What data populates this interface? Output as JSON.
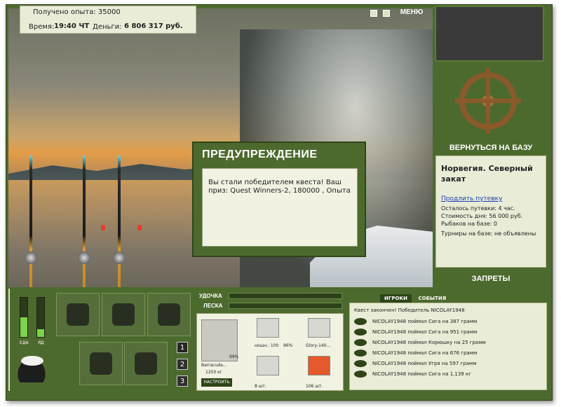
{
  "status": {
    "experience_label": "Получено опыта: 35000",
    "time_label": "Время:",
    "time_value": "19:40 ЧТ",
    "money_label": "Деньги:",
    "money_value": "6 806 317 руб."
  },
  "top": {
    "menu_label": "МЕНЮ"
  },
  "right": {
    "return_label": "ВЕРНУТЬСЯ НА БАЗУ",
    "base_title": "Норвегия. Северный закат",
    "extend_link": "Продлить путевку",
    "lines": [
      "Осталось путевки: 4 час.",
      "Стоимость дня: 56 000 руб.",
      "Рыбаков на базе: 0",
      "Турниры на базе: не объявлены"
    ],
    "bans_label": "ЗАПРЕТЫ"
  },
  "dialog": {
    "title": "ПРЕДУПРЕЖДЕНИЕ",
    "message": "Вы стали победителем квеста! Ваш приз: Quest Winners-2, 180000 , Опыта"
  },
  "left": {
    "gauge_food_label": "ЕДА",
    "gauge_poison_label": "ЯД",
    "gauge_food_value": 0.5,
    "gauge_poison_value": 0.2,
    "pages": [
      "1",
      "2",
      "3"
    ]
  },
  "tackle": {
    "rod_label": "УДОЧКА",
    "line_label": "ЛЕСКА",
    "rod_name": "Barracuda...",
    "rod_weight": "1250 кг",
    "rod_percent": "99%",
    "setup_button": "НАСТРОИТЬ",
    "reel_label": "ношн.: 100",
    "reel_percent": "96%",
    "lure_label": "Glory-140...",
    "hook_count": "8 шт.",
    "bait_count": "106 шт."
  },
  "log": {
    "tab_players": "ИГРОКИ",
    "tab_events": "СОБЫТИЯ",
    "header": "Квест закончен! Победитель NICOLAY1948",
    "entries": [
      "NICOLAY1948 поймал Сига на 387 грамм",
      "NICOLAY1948 поймал Сига на 951 грамм",
      "NICOLAY1948 поймал Корюшку на 25 грамм",
      "NICOLAY1948 поймал Сига на 676 грамм",
      "NICOLAY1948 поймал Угря на 597 грамм",
      "NICOLAY1948 поймал Сига на 1,139 кг"
    ]
  },
  "colors": {
    "frame_green": "#4d6a2e",
    "panel_cream": "#e9ecd6",
    "link_blue": "#1c3fb6"
  }
}
